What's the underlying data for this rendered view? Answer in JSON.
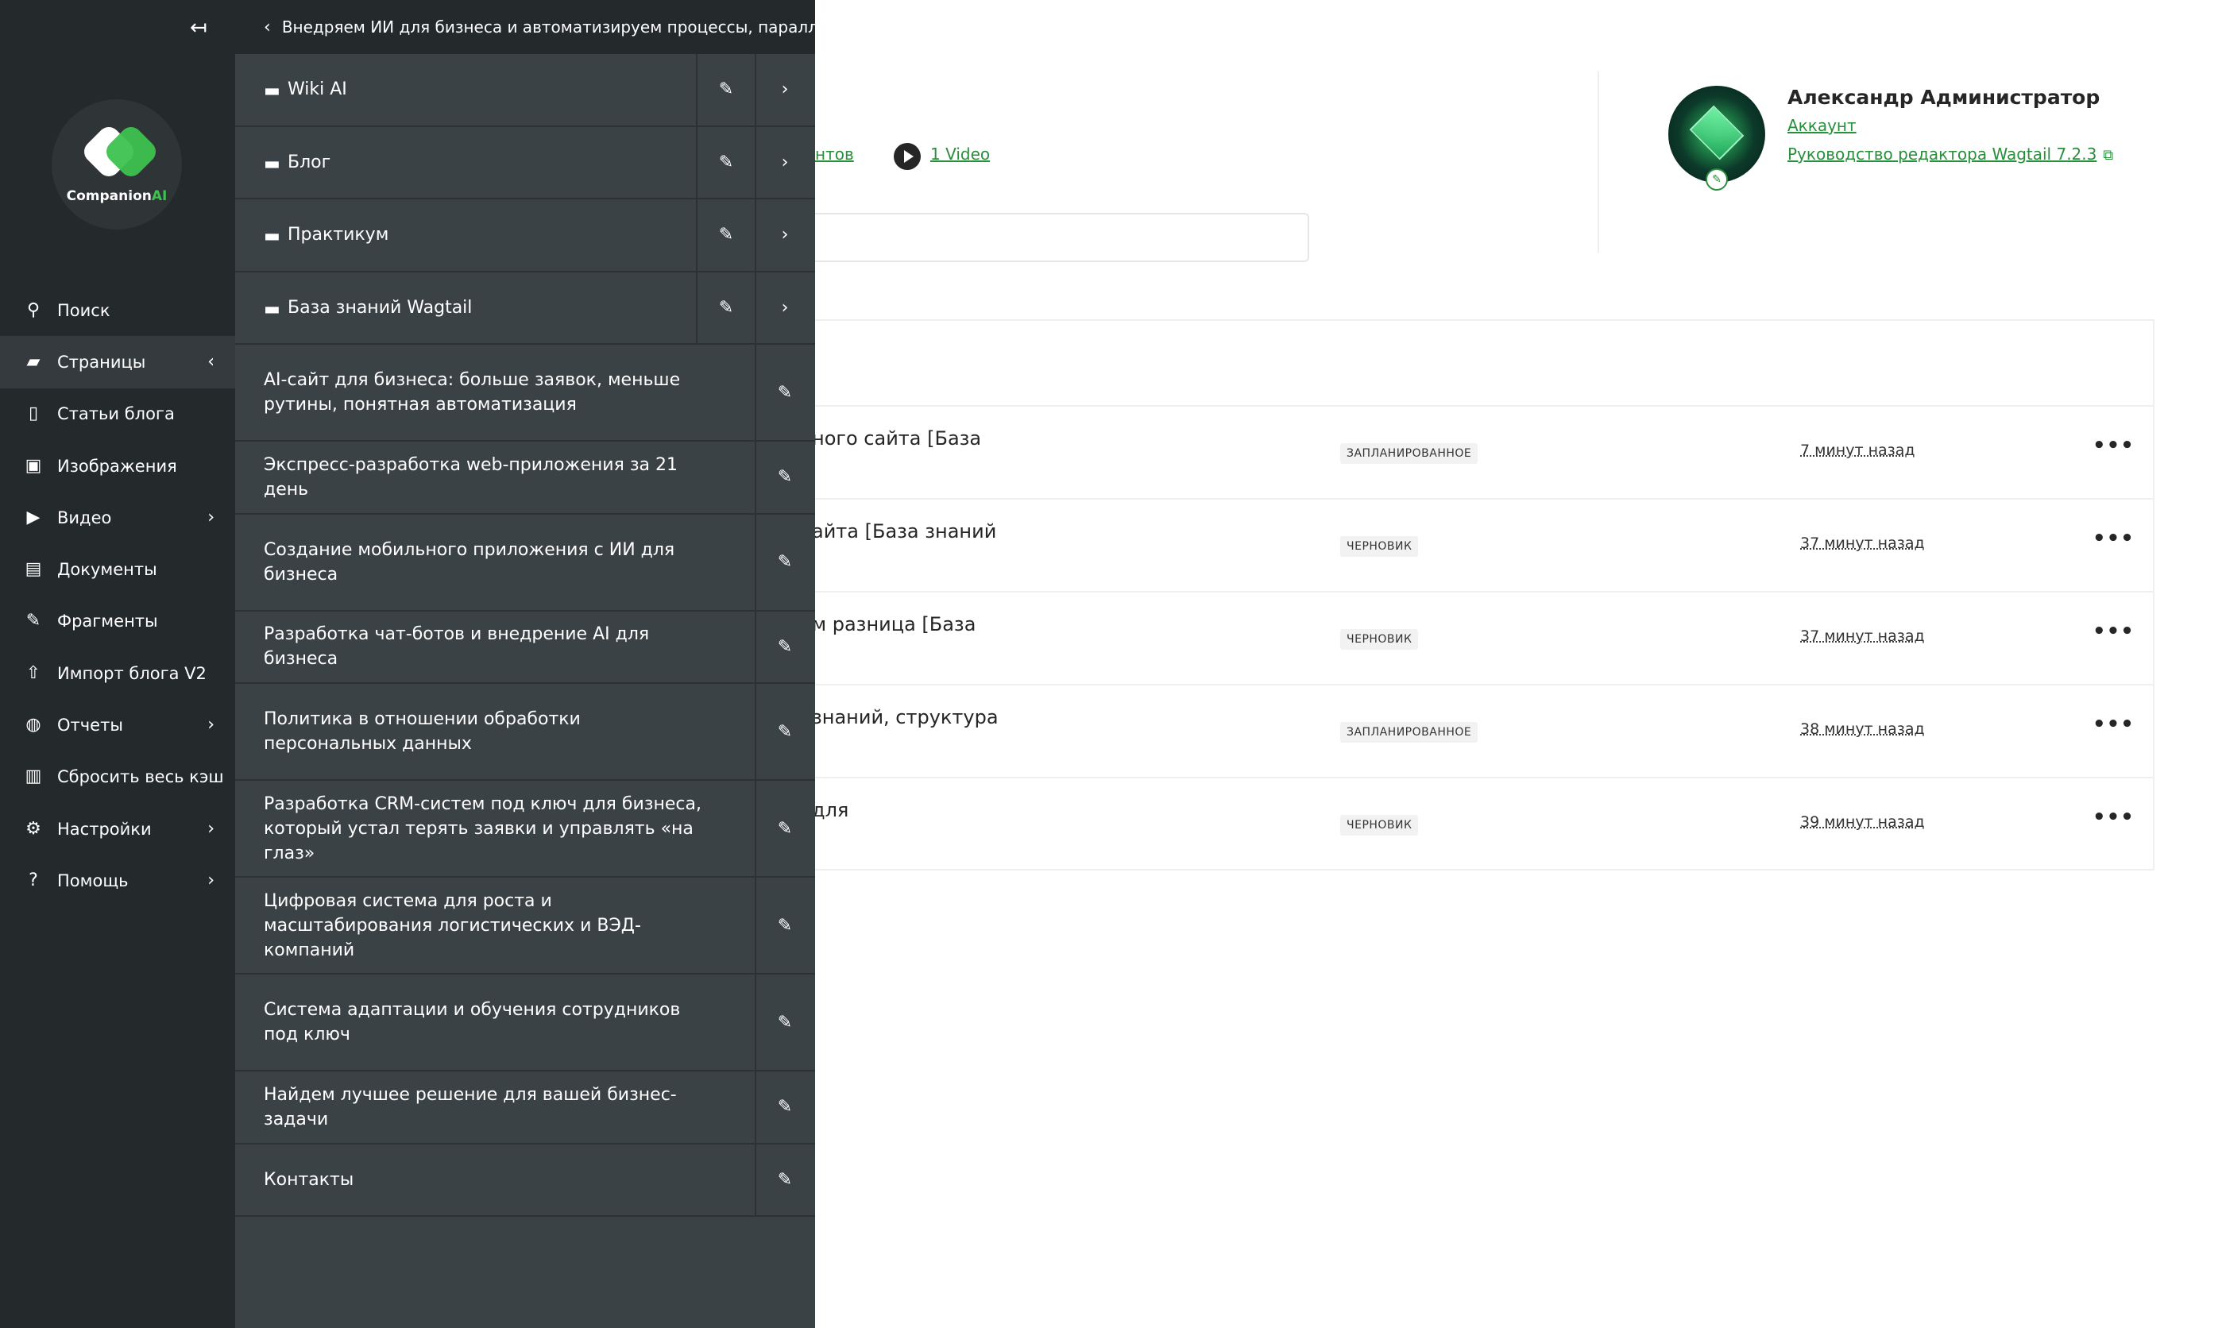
{
  "main": {
    "documents_link_partial": "нтов",
    "video_link": "1 Video",
    "user": {
      "name": "Александр Администратор",
      "account_link": "Аккаунт",
      "guide_link": "Руководство редактора Wagtail 7.2.3"
    },
    "rows": [
      {
        "title": "ного сайта [База",
        "status": "ЗАПЛАНИРОВАННОЕ",
        "time": "7 минут назад"
      },
      {
        "title": "айта [База знаний",
        "status": "ЧЕРНОВИК",
        "time": "37 минут назад"
      },
      {
        "title": "м разница [База",
        "status": "ЧЕРНОВИК",
        "time": "37 минут назад"
      },
      {
        "title": " знаний, структура",
        "status": "ЗАПЛАНИРОВАННОЕ",
        "time": "38 минут назад"
      },
      {
        "title": "для",
        "status": "ЧЕРНОВИК",
        "time": "39 минут назад"
      }
    ],
    "more_glyph": "•••"
  },
  "sidebar": {
    "collapse_glyph": "↤",
    "logo": {
      "text_main": "Companion",
      "text_accent": "AI"
    },
    "items": [
      {
        "label": "Поиск",
        "icon": "search-icon",
        "glyph": "⚲"
      },
      {
        "label": "Страницы",
        "icon": "folder-open-icon",
        "glyph": "▰",
        "chevron": "‹"
      },
      {
        "label": "Статьи блога",
        "icon": "document-icon",
        "glyph": "▯"
      },
      {
        "label": "Изображения",
        "icon": "image-icon",
        "glyph": "▣"
      },
      {
        "label": "Видео",
        "icon": "play-icon",
        "glyph": "▶",
        "chevron": "›"
      },
      {
        "label": "Документы",
        "icon": "doc-icon",
        "glyph": "▤"
      },
      {
        "label": "Фрагменты",
        "icon": "snippet-icon",
        "glyph": "✎"
      },
      {
        "label": "Импорт блога V2",
        "icon": "upload-icon",
        "glyph": "⇧"
      },
      {
        "label": "Отчеты",
        "icon": "globe-icon",
        "glyph": "◍",
        "chevron": "›"
      },
      {
        "label": "Сбросить весь кэш",
        "icon": "trash-icon",
        "glyph": "▥"
      },
      {
        "label": "Настройки",
        "icon": "cogs-icon",
        "glyph": "⚙",
        "chevron": "›"
      },
      {
        "label": "Помощь",
        "icon": "help-icon",
        "glyph": "?",
        "chevron": "›"
      }
    ]
  },
  "explorer": {
    "header": "Внедряем ИИ для бизнеса и автоматизируем процессы, параллельно",
    "back_glyph": "‹",
    "edit_glyph": "✎",
    "next_glyph": "›",
    "folders": [
      {
        "label": "Wiki AI"
      },
      {
        "label": "Блог"
      },
      {
        "label": "Практикум"
      },
      {
        "label": "База знаний Wagtail"
      }
    ],
    "pages": [
      {
        "label": "AI-сайт для бизнеса: больше заявок, меньше рутины, понятная автоматизация"
      },
      {
        "label": "Экспресс-разработка web-приложения за 21 день"
      },
      {
        "label": "Создание мобильного приложения с ИИ для бизнеса"
      },
      {
        "label": "Разработка чат-ботов и внедрение AI для бизнеса"
      },
      {
        "label": "Политика в отношении обработки персональных данных"
      },
      {
        "label": "Разработка CRM-систем под ключ для бизнеса, который устал терять заявки и управлять «на глаз»"
      },
      {
        "label": "Цифровая система для роста и масштабирования логистических и ВЭД-компаний"
      },
      {
        "label": "Система адаптации и обучения сотрудников под ключ"
      },
      {
        "label": "Найдем лучшее решение для вашей бизнес-задачи"
      },
      {
        "label": "Контакты"
      }
    ]
  }
}
